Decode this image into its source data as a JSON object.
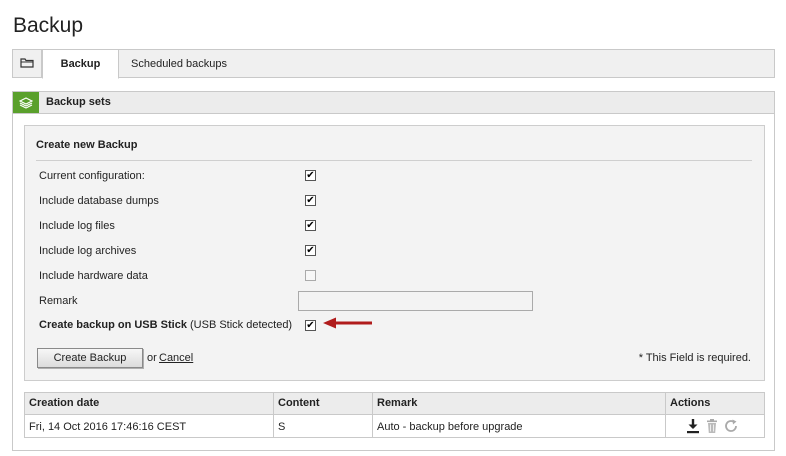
{
  "page": {
    "title": "Backup"
  },
  "tabs": {
    "folder_icon": "folder-icon",
    "items": [
      {
        "label": "Backup",
        "active": true
      },
      {
        "label": "Scheduled backups",
        "active": false
      }
    ]
  },
  "panel": {
    "icon": "layers-icon",
    "title": "Backup sets",
    "accent_color": "#5aa02c"
  },
  "form": {
    "title": "Create new Backup",
    "rows": [
      {
        "label": "Current configuration:",
        "checked": true,
        "disabled": false
      },
      {
        "label": "Include database dumps",
        "checked": true,
        "disabled": false
      },
      {
        "label": "Include log files",
        "checked": true,
        "disabled": false
      },
      {
        "label": "Include log archives",
        "checked": true,
        "disabled": false
      },
      {
        "label": "Include hardware data",
        "checked": false,
        "disabled": true
      }
    ],
    "remark_label": "Remark",
    "remark_value": "",
    "usb_label_bold": "Create backup on USB Stick",
    "usb_label_note": "(USB Stick detected)",
    "usb_checked": true,
    "arrow_color": "#b01c1c",
    "create_button": "Create Backup",
    "or_text": "or",
    "cancel_link": "Cancel",
    "required_note": "* This Field is required."
  },
  "table": {
    "headers": [
      "Creation date",
      "Content",
      "Remark",
      "Actions"
    ],
    "rows": [
      {
        "creation_date": "Fri, 14 Oct 2016 17:46:16 CEST",
        "content": "S",
        "remark": "Auto - backup before upgrade",
        "actions": [
          "download-icon",
          "trash-icon",
          "restore-icon"
        ]
      }
    ]
  }
}
